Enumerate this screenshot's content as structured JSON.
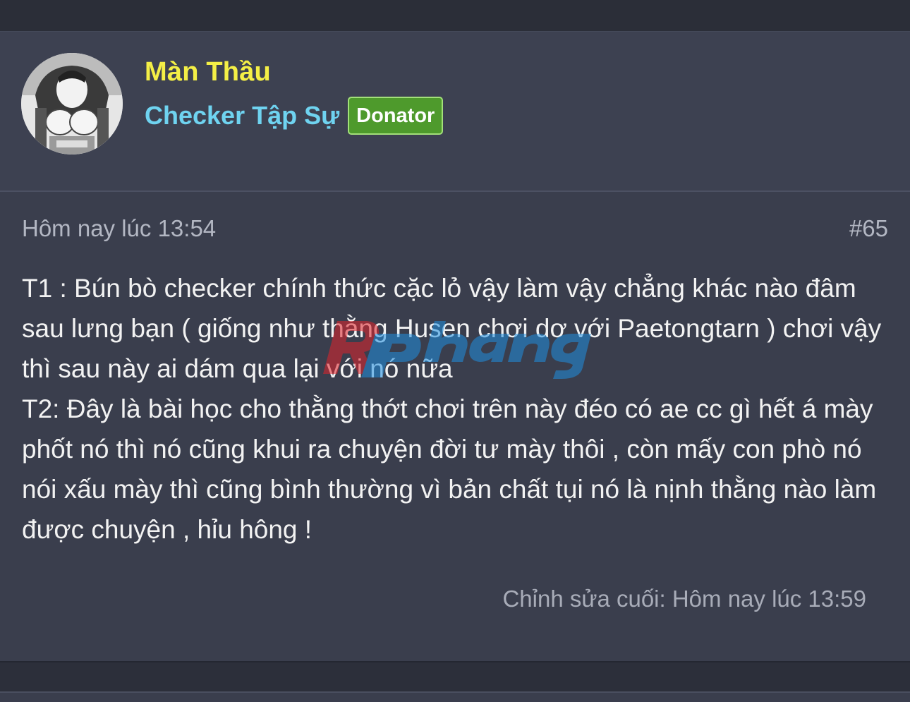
{
  "post": {
    "author": {
      "name": "Màn Thầu",
      "rank": "Checker Tập Sự",
      "badge": "Donator"
    },
    "time": "Hôm nay lúc 13:54",
    "number": "#65",
    "paragraphs": [
      "T1 : Bún bò checker chính thức cặc lỏ vậy làm vậy chẳng khác nào đâm sau lưng bạn ( giống như thằng Husen chơi dơ với Paetongtarn ) chơi vậy thì sau này ai dám qua lại với nó nữa",
      "T2: Đây là bài học cho thằng thớt chơi trên này đéo có ae cc gì hết á mày phốt nó thì nó cũng khui ra chuyện đời tư mày thôi , còn mấy con phò nó nói xấu mày thì cũng bình thường vì bản chất tụi nó là nịnh thằng nào làm được chuyện , hỉu hông !"
    ],
    "edited": "Chỉnh sửa cuối: Hôm nay lúc 13:59"
  },
  "colors": {
    "username": "#f4ef46",
    "rank": "#6fd3f0",
    "badge_bg": "#4e9a2c"
  }
}
